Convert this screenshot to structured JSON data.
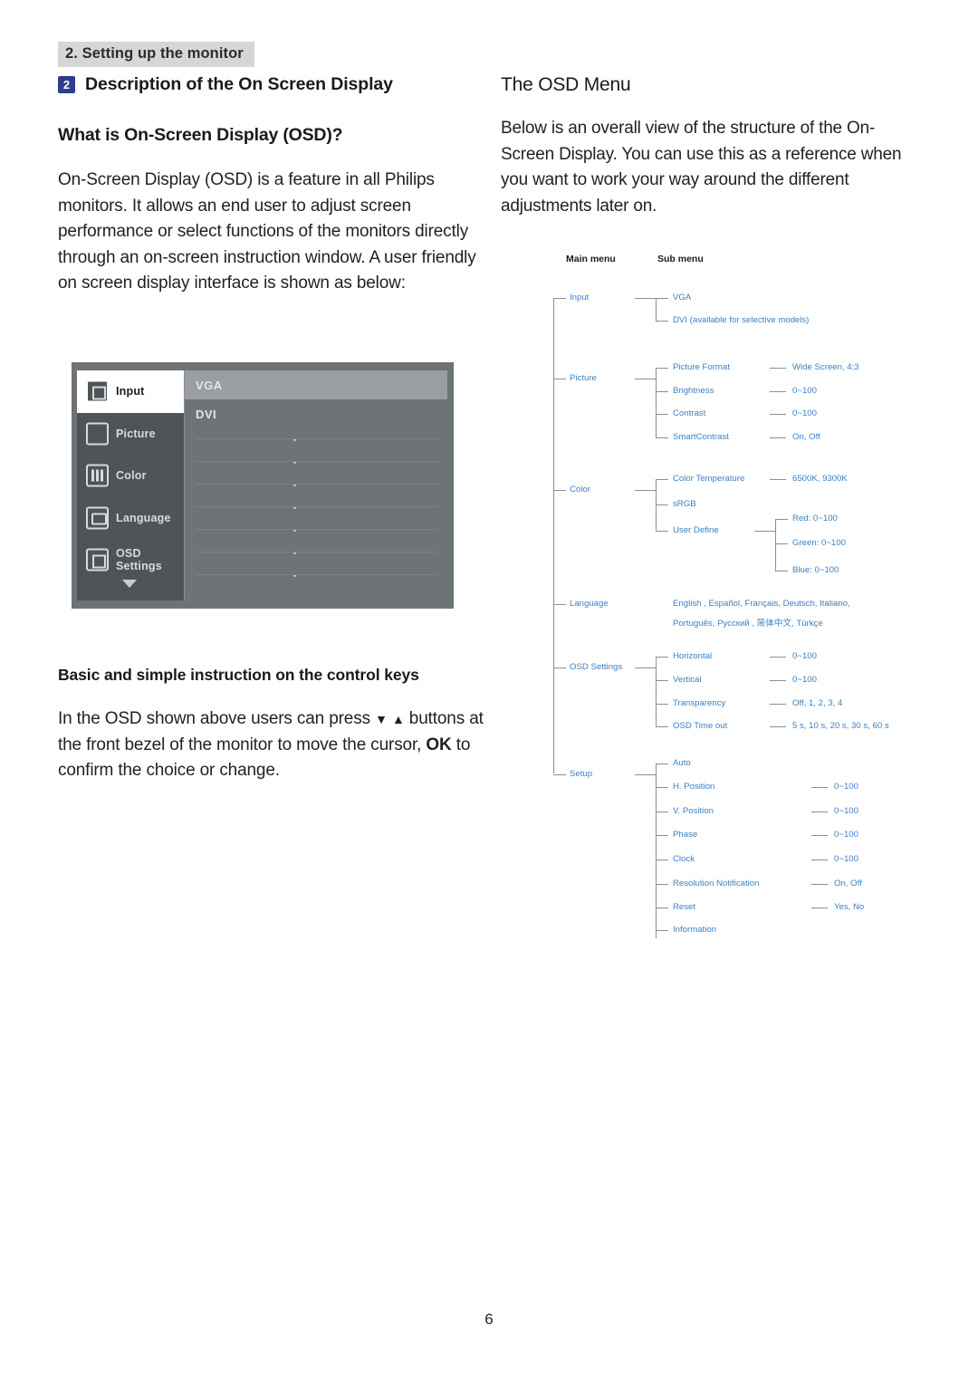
{
  "header": {
    "chapter": "2. Setting up the monitor"
  },
  "left": {
    "section_number": "2",
    "section_title": "Description of the On Screen Display",
    "sub_head": "What is On-Screen Display (OSD)?",
    "body": "On-Screen Display (OSD) is a feature in all Philips monitors. It allows an end user to adjust screen performance or select functions of the monitors directly through an on-screen instruction window. A user friendly on screen display interface is shown as below:",
    "ctrl_head": "Basic and simple instruction on the control keys",
    "ctrl_text_1": "In the OSD shown above users can press",
    "ctrl_text_2": "buttons at the front bezel of the monitor to move the cursor,",
    "ctrl_ok": "OK",
    "ctrl_text_3": "to confirm the choice or change."
  },
  "osd_illustration": {
    "menu_items": [
      {
        "label": "Input",
        "active": true
      },
      {
        "label": "Picture",
        "active": false
      },
      {
        "label": "Color",
        "active": false
      },
      {
        "label": "Language",
        "active": false
      },
      {
        "label": "OSD Settings",
        "active": false
      }
    ],
    "sub_items": [
      {
        "label": "VGA",
        "highlight": true
      },
      {
        "label": "DVI",
        "highlight": false
      }
    ]
  },
  "right": {
    "head": "The OSD Menu",
    "body": "Below is an overall view of the structure of the On-Screen Display. You can use this as a reference when you want to work your way around the different adjustments later on."
  },
  "tree": {
    "col_headers": {
      "main": "Main menu",
      "sub": "Sub menu"
    },
    "input": {
      "label": "Input",
      "children": [
        "VGA",
        "DVI (available for selective models)"
      ]
    },
    "picture": {
      "label": "Picture",
      "children": [
        {
          "label": "Picture Format",
          "value": "Wide Screen, 4:3"
        },
        {
          "label": "Brightness",
          "value": "0~100"
        },
        {
          "label": "Contrast",
          "value": "0~100"
        },
        {
          "label": "SmartContrast",
          "value": "On, Off"
        }
      ]
    },
    "color": {
      "label": "Color",
      "children": [
        {
          "label": "Color Temperature",
          "value": "6500K, 9300K"
        },
        {
          "label": "sRGB",
          "value": ""
        },
        {
          "label": "User Define",
          "value": ""
        }
      ],
      "user_define": [
        "Red: 0~100",
        "Green: 0~100",
        "Blue: 0~100"
      ]
    },
    "language": {
      "label": "Language",
      "line1": "English , Español, Français, Deutsch, Italiano,",
      "line2": "Português, Русский , 简体中文, Türkçe"
    },
    "osd_settings": {
      "label": "OSD Settings",
      "children": [
        {
          "label": "Horizontal",
          "value": "0~100"
        },
        {
          "label": "Vertical",
          "value": "0~100"
        },
        {
          "label": "Transparency",
          "value": "Off, 1, 2, 3, 4"
        },
        {
          "label": "OSD Time out",
          "value": "5 s, 10 s, 20 s, 30 s, 60 s"
        }
      ]
    },
    "setup": {
      "label": "Setup",
      "children": [
        {
          "label": "Auto",
          "value": ""
        },
        {
          "label": "H. Position",
          "value": "0~100"
        },
        {
          "label": "V. Position",
          "value": "0~100"
        },
        {
          "label": "Phase",
          "value": "0~100"
        },
        {
          "label": "Clock",
          "value": "0~100"
        },
        {
          "label": "Resolution Notification",
          "value": "On, Off"
        },
        {
          "label": "Reset",
          "value": "Yes, No"
        },
        {
          "label": "Information",
          "value": ""
        }
      ]
    }
  },
  "footer": {
    "page": "6"
  }
}
